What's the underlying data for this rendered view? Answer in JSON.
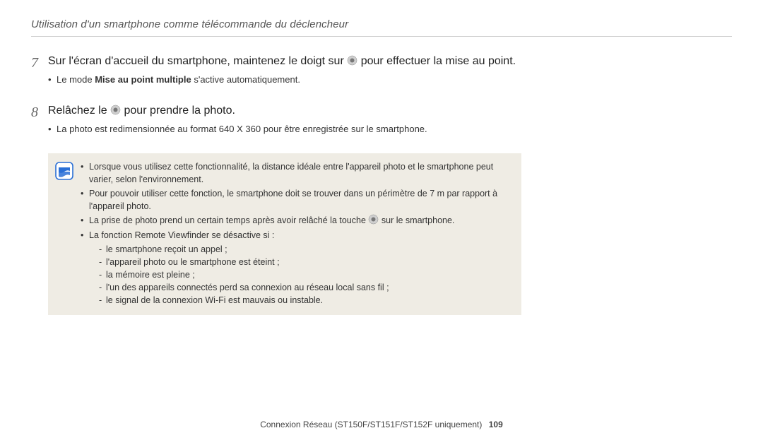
{
  "header": {
    "title": "Utilisation d'un smartphone comme télécommande du déclencheur"
  },
  "steps": [
    {
      "num": "7",
      "text_before": "Sur l'écran d'accueil du smartphone, maintenez le doigt sur ",
      "text_after": " pour effectuer la mise au point.",
      "bullets": [
        {
          "pre": "Le mode ",
          "bold": "Mise au point multiple",
          "post": " s'active automatiquement."
        }
      ]
    },
    {
      "num": "8",
      "text_before": "Relâchez le ",
      "text_after": " pour prendre la photo.",
      "bullets": [
        {
          "pre": "La photo est redimensionnée au format 640 X 360 pour être enregistrée sur le smartphone.",
          "bold": "",
          "post": ""
        }
      ]
    }
  ],
  "note": {
    "items": [
      "Lorsque vous utilisez cette fonctionnalité, la distance idéale entre l'appareil photo et le smartphone peut varier, selon l'environnement.",
      "Pour pouvoir utiliser cette fonction, le smartphone doit se trouver dans un périmètre de 7 m par rapport à l'appareil photo.",
      "__icon__La prise de photo prend un certain temps après avoir relâché la touche |ICON| sur le smartphone.",
      "La fonction Remote Viewfinder se désactive si :"
    ],
    "dashes": [
      "le smartphone reçoit un appel ;",
      "l'appareil photo ou le smartphone est éteint ;",
      "la mémoire est pleine ;",
      "l'un des appareils connectés perd sa connexion au réseau local sans fil ;",
      "le signal de la connexion Wi-Fi est mauvais ou instable."
    ],
    "icon_sentence_pre": "La prise de photo prend un certain temps après avoir relâché la touche ",
    "icon_sentence_post": " sur le smartphone."
  },
  "footer": {
    "text": "Connexion Réseau (ST150F/ST151F/ST152F uniquement)",
    "page": "109"
  },
  "icons": {
    "shutter": "shutter-icon",
    "note": "note-icon"
  }
}
